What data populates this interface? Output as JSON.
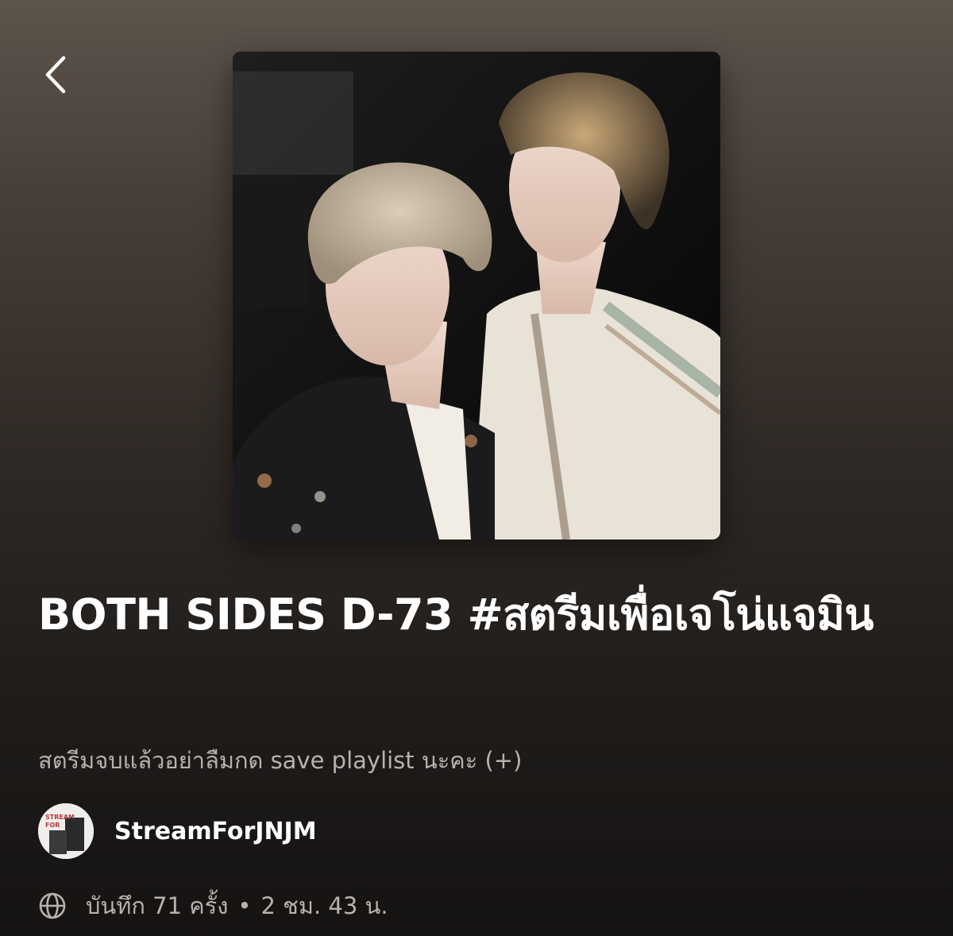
{
  "header": {
    "back_icon": "chevron-left-icon"
  },
  "cover": {
    "description": "playlist-cover-photo"
  },
  "playlist": {
    "title": "BOTH SIDES D-73 #สตรีมเพื่อเจโน่แจมิน",
    "description": "สตรีมจบแล้วอย่าลืมกด save playlist นะคะ (+)",
    "owner": {
      "name": "StreamForJNJM",
      "avatar_text": "STREAM FOR JNJM"
    },
    "visibility_icon": "globe-icon",
    "saves": "บันทึก 71 ครั้ง",
    "separator": "•",
    "duration": "2 ชม. 43 น."
  },
  "colors": {
    "background_top": "#5d544c",
    "background_bottom": "#151312",
    "secondary_text": "#b8b2ad"
  }
}
